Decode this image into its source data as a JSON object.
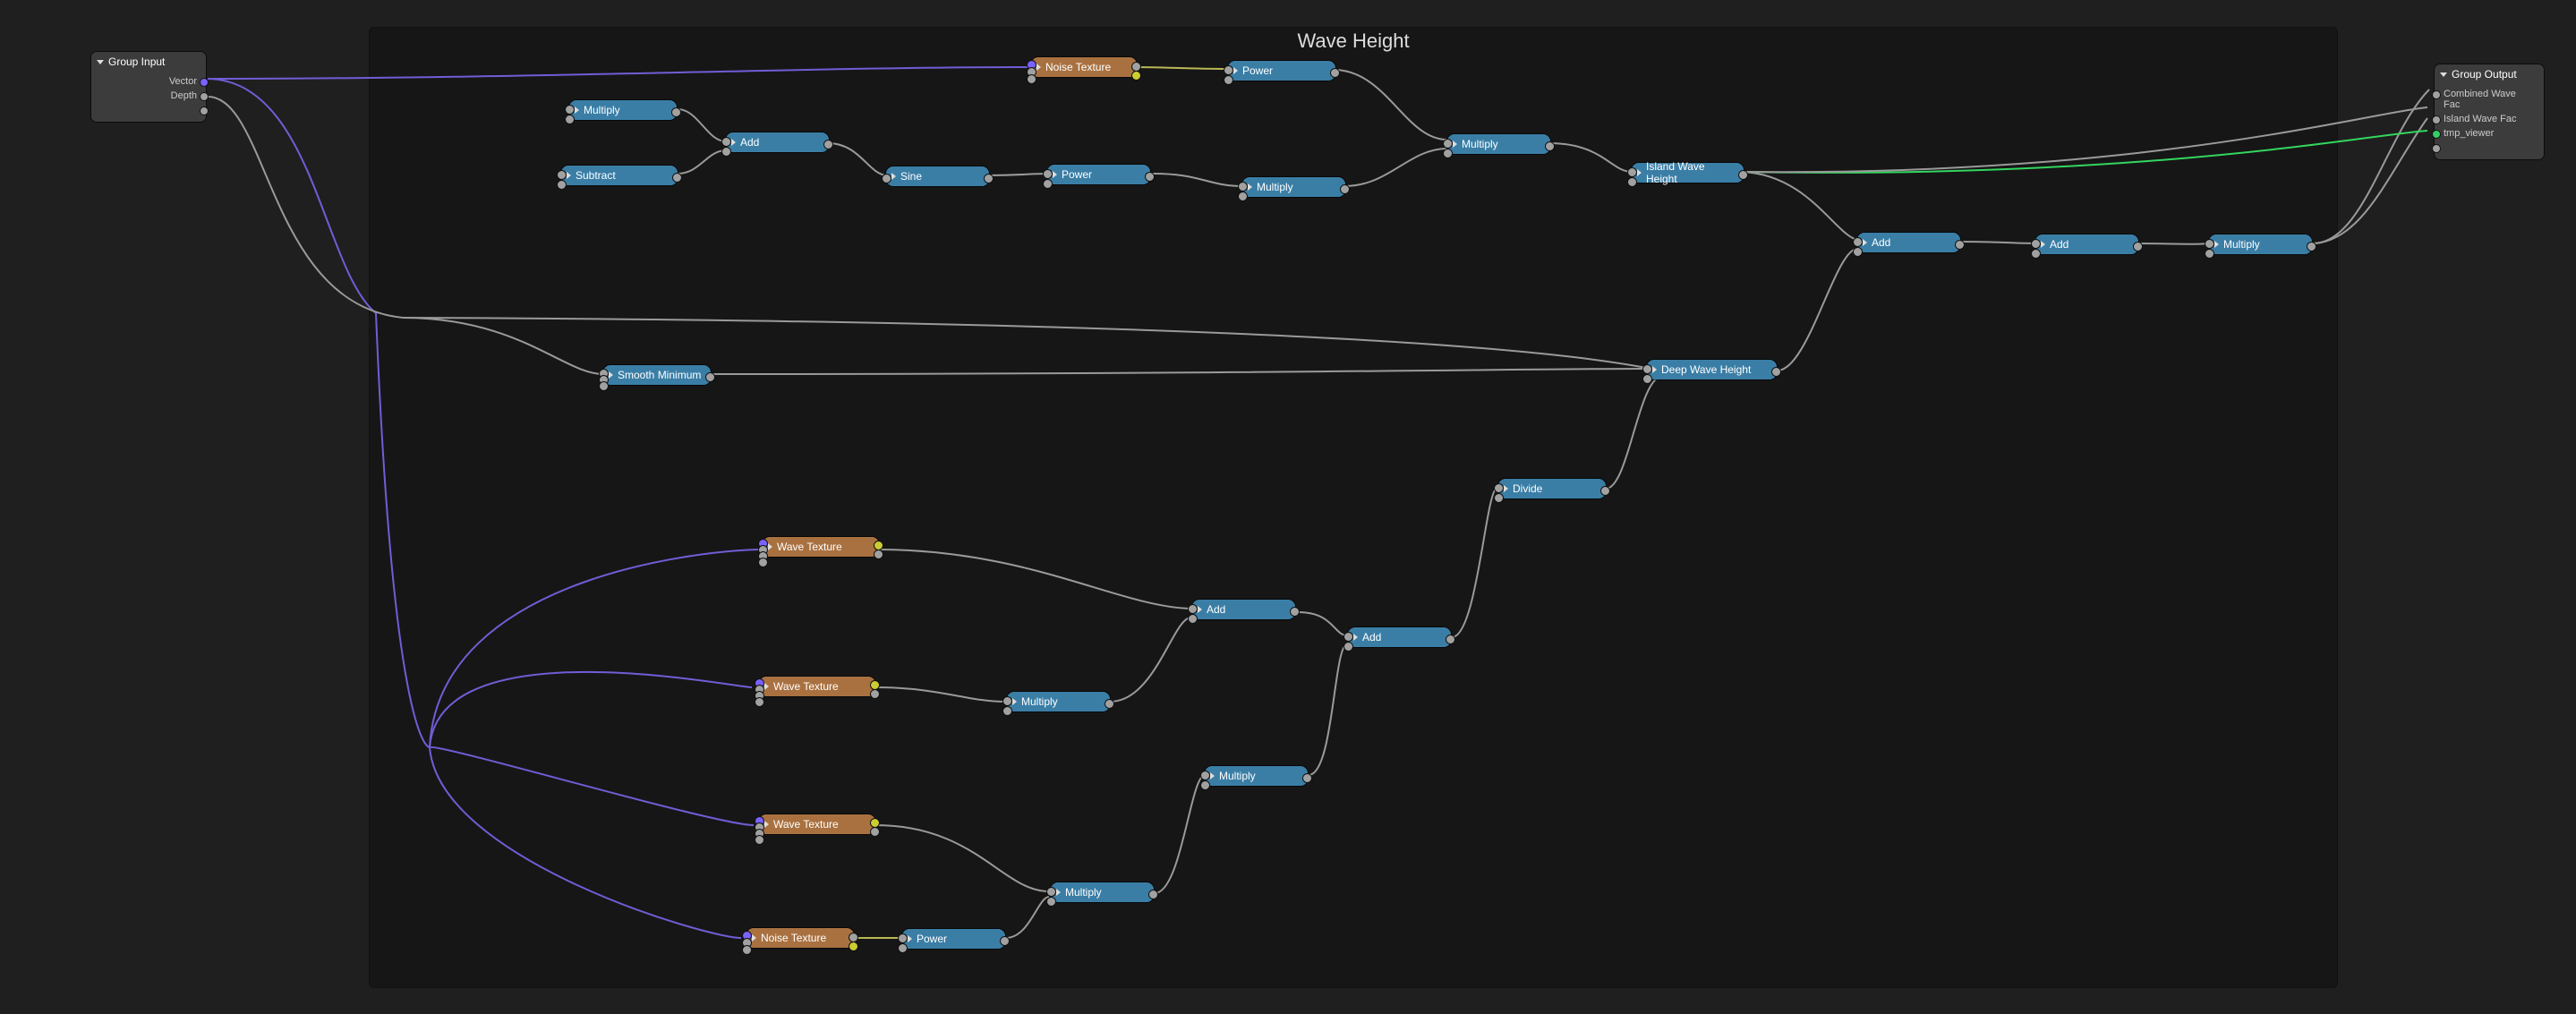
{
  "frame": {
    "title": "Wave Height"
  },
  "group_input": {
    "title": "Group Input",
    "out_vector": "Vector",
    "out_depth": "Depth"
  },
  "group_output": {
    "title": "Group Output",
    "in_combined": "Combined Wave Fac",
    "in_island": "Island Wave Fac",
    "in_tmp": "tmp_viewer"
  },
  "nodes": {
    "multiply1": "Multiply",
    "subtract1": "Subtract",
    "add1": "Add",
    "sine1": "Sine",
    "noise_tex1": "Noise Texture",
    "power1": "Power",
    "power2": "Power",
    "multiply2": "Multiply",
    "multiply3": "Multiply",
    "island_wh": "Island Wave Height",
    "smooth_min": "Smooth Minimum",
    "deep_wh": "Deep Wave Height",
    "divide1": "Divide",
    "add2": "Add",
    "add3": "Add",
    "multiply4": "Multiply",
    "add_top2": "Add",
    "add_top3": "Add",
    "multiply_top": "Multiply",
    "wave_tex1": "Wave Texture",
    "wave_tex2": "Wave Texture",
    "wave_tex3": "Wave Texture",
    "noise_tex2": "Noise Texture",
    "multiply5": "Multiply",
    "multiply6": "Multiply",
    "power3": "Power"
  }
}
